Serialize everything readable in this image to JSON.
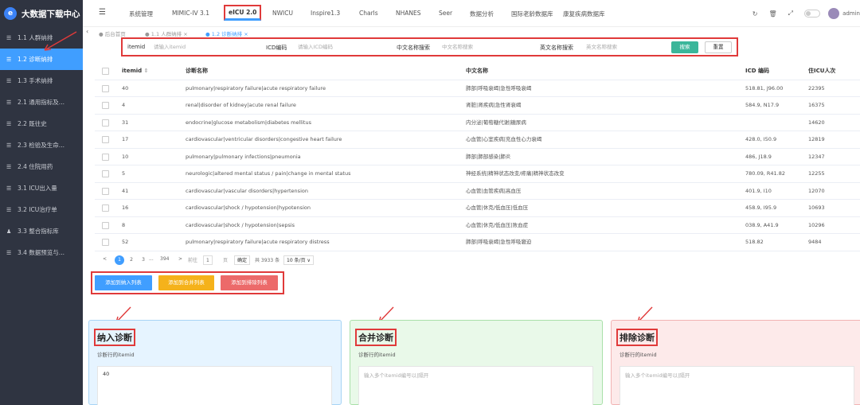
{
  "app": {
    "title": "大数据下载中心",
    "logo_glyph": "e"
  },
  "sidebar": {
    "items": [
      {
        "label": "1.1 人群纳排",
        "icon": "list-icon"
      },
      {
        "label": "1.2 诊断纳排",
        "icon": "list-icon"
      },
      {
        "label": "1.3 手术纳排",
        "icon": "list-icon"
      },
      {
        "label": "2.1 通用指标及...",
        "icon": "list-icon"
      },
      {
        "label": "2.2 既往史",
        "icon": "list-icon"
      },
      {
        "label": "2.3 检验及生命...",
        "icon": "list-icon"
      },
      {
        "label": "2.4 住院用药",
        "icon": "list-icon"
      },
      {
        "label": "3.1 ICU出入量",
        "icon": "list-icon"
      },
      {
        "label": "3.2 ICU治疗单",
        "icon": "list-icon"
      },
      {
        "label": "3.3 整合指标库",
        "icon": "person-icon"
      },
      {
        "label": "3.4 数据预览与...",
        "icon": "list-icon"
      }
    ]
  },
  "topnav": {
    "tabs": [
      "系统管理",
      "MIMIC-IV 3.1",
      "eICU 2.0",
      "NWICU",
      "Inspire1.3",
      "Charls",
      "NHANES",
      "Seer",
      "数据分析",
      "国际老龄数据库",
      "康复疾病数据库"
    ],
    "user": "admin"
  },
  "tags": {
    "home": "后台首页",
    "t1": "1.1 人群纳排",
    "t2": "1.2 诊断纳排"
  },
  "search": {
    "itemid_label": "itemid",
    "itemid_ph": "请输入itemid",
    "icd_label": "ICD编码",
    "icd_ph": "请输入ICD编码",
    "cn_label": "中文名称搜索",
    "cn_ph": "中文名称搜索",
    "en_label": "英文名称搜索",
    "en_ph": "英文名称搜索",
    "search_btn": "搜索",
    "reset_btn": "重置"
  },
  "table": {
    "headers": {
      "itemid": "itemid",
      "en": "诊断名称",
      "cn": "中文名称",
      "icd": "ICD 编码",
      "count": "住ICU人次"
    },
    "sort_glyph": "⇕",
    "rows": [
      {
        "itemid": "40",
        "en": "pulmonary|respiratory failure|acute respiratory failure",
        "cn": "肺部|呼吸衰竭|急性呼吸衰竭",
        "icd": "518.81, J96.00",
        "count": "22395"
      },
      {
        "itemid": "4",
        "en": "renal|disorder of kidney|acute renal failure",
        "cn": "肾脏|肾疾病|急性肾衰竭",
        "icd": "584.9, N17.9",
        "count": "16375"
      },
      {
        "itemid": "31",
        "en": "endocrine|glucose metabolism|diabetes mellitus",
        "cn": "内分泌|葡萄糖代谢|糖尿病",
        "icd": "",
        "count": "14620"
      },
      {
        "itemid": "17",
        "en": "cardiovascular|ventricular disorders|congestive heart failure",
        "cn": "心血管|心室疾病|充血性心力衰竭",
        "icd": "428.0, I50.9",
        "count": "12819"
      },
      {
        "itemid": "10",
        "en": "pulmonary|pulmonary infections|pneumonia",
        "cn": "肺部|肺部感染|肺炎",
        "icd": "486, J18.9",
        "count": "12347"
      },
      {
        "itemid": "5",
        "en": "neurologic|altered mental status / pain|change in mental status",
        "cn": "神经系统|精神状态改变/疼痛|精神状态改变",
        "icd": "780.09, R41.82",
        "count": "12255"
      },
      {
        "itemid": "41",
        "en": "cardiovascular|vascular disorders|hypertension",
        "cn": "心血管|血管疾病|高血压",
        "icd": "401.9, I10",
        "count": "12070"
      },
      {
        "itemid": "16",
        "en": "cardiovascular|shock / hypotension|hypotension",
        "cn": "心血管|休克/低血压|低血压",
        "icd": "458.9, I95.9",
        "count": "10693"
      },
      {
        "itemid": "8",
        "en": "cardiovascular|shock / hypotension|sepsis",
        "cn": "心血管|休克/低血压|败血症",
        "icd": "038.9, A41.9",
        "count": "10296"
      },
      {
        "itemid": "52",
        "en": "pulmonary|respiratory failure|acute respiratory distress",
        "cn": "肺部|呼吸衰竭|急性呼吸窘迫",
        "icd": "518.82",
        "count": "9484"
      }
    ]
  },
  "pager": {
    "prev": "<",
    "p1": "1",
    "p2": "2",
    "p3": "3",
    "dots": "...",
    "last": "394",
    "next": ">",
    "goto": "前往",
    "page_val": "1",
    "page_unit": "页",
    "confirm": "确定",
    "total": "共 3933 条",
    "size": "10 条/页 ∨"
  },
  "actions": {
    "include": "添加到纳入列表",
    "merge": "添加到合并列表",
    "exclude": "添加到排除列表"
  },
  "panels": {
    "include": {
      "title": "纳入诊断",
      "sub": "诊断行的itemid",
      "value": "40"
    },
    "merge": {
      "title": "合并诊断",
      "sub": "诊断行的itemid",
      "placeholder": "输入多个itemid编号以|隔开"
    },
    "exclude": {
      "title": "排除诊断",
      "sub": "诊断行的itemid",
      "placeholder": "输入多个itemid编号以|隔开"
    }
  },
  "colors": {
    "sidebar": "#2f3441",
    "accent": "#409eff",
    "highlight": "#e03a3a",
    "search_btn": "#3bb69a",
    "include_btn": "#409eff",
    "merge_btn": "#f5b21b",
    "exclude_btn": "#ec6a6a"
  }
}
